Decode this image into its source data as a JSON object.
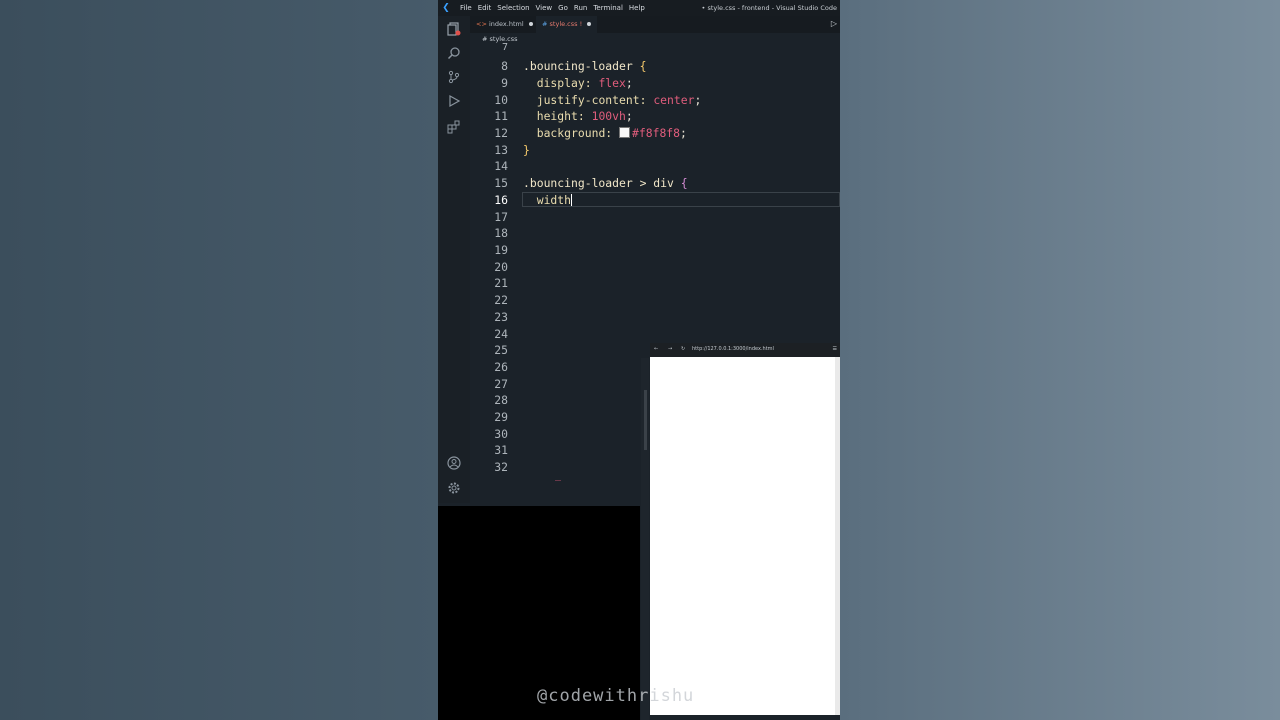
{
  "menu": [
    "File",
    "Edit",
    "Selection",
    "View",
    "Go",
    "Run",
    "Terminal",
    "Help"
  ],
  "window_title": "• style.css - frontend - Visual Studio Code",
  "tabs": [
    {
      "label": "index.html"
    },
    {
      "label": "style.css"
    }
  ],
  "tab_style_suffix": "!",
  "breadcrumb": "# style.css",
  "line_numbers": [
    "7",
    "8",
    "9",
    "10",
    "11",
    "12",
    "13",
    "14",
    "15",
    "16",
    "17",
    "18",
    "19",
    "20",
    "21",
    "22",
    "23",
    "24",
    "25",
    "26",
    "27",
    "28",
    "29",
    "30",
    "31",
    "32"
  ],
  "code": {
    "l8_selector": ".bouncing-loader",
    "l8_brace": "{",
    "l9_prop": "display:",
    "l9_val": "flex",
    "l10_prop": "justify-content:",
    "l10_val": "center",
    "l11_prop": "height:",
    "l11_val": "100vh",
    "l12_prop": "background:",
    "l12_val": "#f8f8f8",
    "semicolon": ";",
    "l13_brace": "}",
    "l15_selector": ".bouncing-loader > div",
    "l15_brace": "{",
    "l16_text": "width"
  },
  "browser_url": "http://127.0.0.1:3000/index.html",
  "watermark": "@codewithrishu",
  "colors": {
    "accent": "#3aa0ff",
    "keyword_value": "#e05d7c",
    "swatch": "#f8f8f8"
  }
}
